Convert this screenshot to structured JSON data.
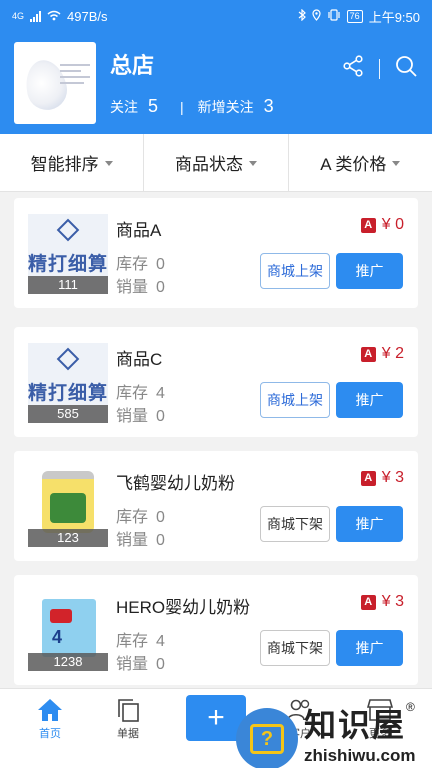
{
  "status_bar": {
    "network": "4G",
    "speed": "497B/s",
    "battery": "76",
    "time": "上午9:50"
  },
  "store": {
    "name": "总店",
    "follow_label": "关注",
    "follow_count": "5",
    "separator": "|",
    "new_follow_label": "新增关注",
    "new_follow_count": "3"
  },
  "sort_bar": [
    {
      "label": "智能排序"
    },
    {
      "label": "商品状态"
    },
    {
      "label": "A 类价格"
    }
  ],
  "labels": {
    "stock": "库存",
    "sales": "销量",
    "price_badge": "A",
    "promote": "推广"
  },
  "products": [
    {
      "name": "商品A",
      "stock": "0",
      "sales": "0",
      "price": "¥ 0",
      "count": "111",
      "shelf_label": "商城上架",
      "image": "jingdaxiyao-logo"
    },
    {
      "name": "商品C",
      "stock": "4",
      "sales": "0",
      "price": "¥ 2",
      "count": "585",
      "shelf_label": "商城上架",
      "image": "jingdaxiyao-logo"
    },
    {
      "name": "飞鹤婴幼儿奶粉",
      "stock": "0",
      "sales": "0",
      "price": "¥ 3",
      "count": "123",
      "shelf_label": "商城下架",
      "image": "formula-can"
    },
    {
      "name": "HERO婴幼儿奶粉",
      "stock": "4",
      "sales": "0",
      "price": "¥ 3",
      "count": "1238",
      "shelf_label": "商城下架",
      "image": "formula-box"
    }
  ],
  "bottom_nav": {
    "home": "首页",
    "orders": "单据",
    "add": "+",
    "customers": "客户",
    "more": "更多"
  },
  "watermark": {
    "title": "知识屋",
    "reg": "®",
    "url": "zhishiwu.com"
  },
  "colors": {
    "primary": "#2d8cf0",
    "price": "#c81f2b",
    "background": "#f2f2f2"
  }
}
